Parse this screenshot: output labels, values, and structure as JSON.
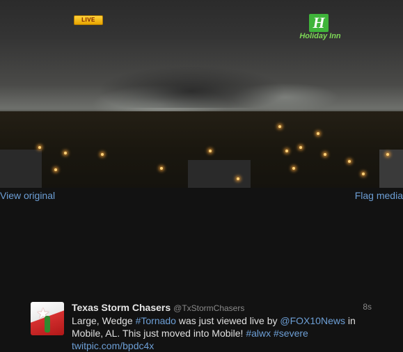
{
  "media": {
    "live_label": "LIVE",
    "sponsor_logo_letter": "H",
    "sponsor_name": "Holiday Inn"
  },
  "links": {
    "view_original": "View original",
    "flag_media": "Flag media"
  },
  "tweet": {
    "display_name": "Texas Storm Chasers",
    "handle": "@TxStormChasers",
    "time": "8s",
    "segments": [
      {
        "text": "Large, Wedge ",
        "link": false
      },
      {
        "text": "#Tornado",
        "link": true
      },
      {
        "text": " was just viewed live by ",
        "link": false
      },
      {
        "text": "@FOX10News",
        "link": true
      },
      {
        "text": " in Mobile, AL. This just moved into Mobile! ",
        "link": false
      },
      {
        "text": "#alwx",
        "link": true
      },
      {
        "text": " ",
        "link": false
      },
      {
        "text": "#severe",
        "link": true
      },
      {
        "text": " ",
        "link": false
      },
      {
        "text": "twitpic.com/bpdc4x",
        "link": true
      }
    ]
  },
  "colors": {
    "background": "#121212",
    "link": "#6d9fd6",
    "live_badge": "#f2b600",
    "sponsor_green": "#3fb43a"
  }
}
